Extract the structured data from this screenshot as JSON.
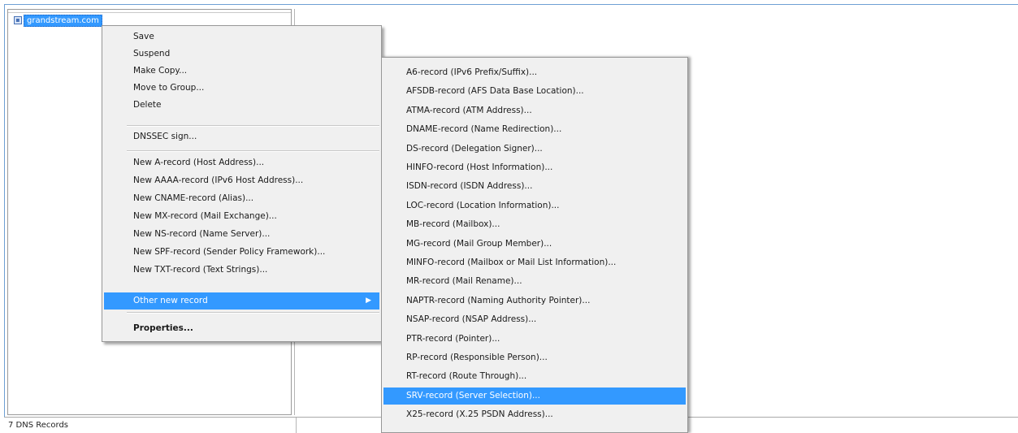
{
  "tree": {
    "item_label": "grandstream.com"
  },
  "status": {
    "text": "7 DNS Records"
  },
  "context_menu": {
    "group1": [
      "Save",
      "Suspend",
      "Make Copy...",
      "Move to Group...",
      "Delete"
    ],
    "dnssec": "DNSSEC sign...",
    "new_records": [
      "New A-record (Host Address)...",
      "New AAAA-record (IPv6 Host Address)...",
      "New CNAME-record (Alias)...",
      "New MX-record (Mail Exchange)...",
      "New NS-record (Name Server)...",
      "New SPF-record (Sender Policy Framework)...",
      "New TXT-record (Text Strings)..."
    ],
    "other_new_record": "Other new record",
    "properties": "Properties..."
  },
  "submenu": {
    "items": [
      "A6-record (IPv6 Prefix/Suffix)...",
      "AFSDB-record (AFS Data Base Location)...",
      "ATMA-record (ATM Address)...",
      "DNAME-record (Name Redirection)...",
      "DS-record (Delegation Signer)...",
      "HINFO-record (Host Information)...",
      "ISDN-record (ISDN Address)...",
      "LOC-record (Location Information)...",
      "MB-record (Mailbox)...",
      "MG-record (Mail Group Member)...",
      "MINFO-record (Mailbox or Mail List Information)...",
      "MR-record (Mail Rename)...",
      "NAPTR-record (Naming Authority Pointer)...",
      "NSAP-record (NSAP Address)...",
      "PTR-record (Pointer)...",
      "RP-record (Responsible Person)...",
      "RT-record (Route Through)...",
      "SRV-record (Server Selection)...",
      "X25-record (X.25 PSDN Address)..."
    ],
    "highlighted_index": 17
  },
  "colors": {
    "highlight": "#3399ff",
    "menu_bg": "#f0f0f0"
  }
}
